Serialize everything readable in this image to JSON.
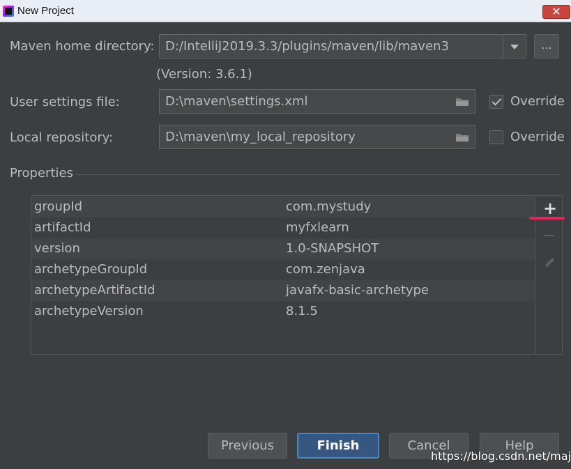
{
  "window": {
    "title": "New Project",
    "close_label": "✕"
  },
  "form": {
    "maven_home": {
      "label": "Maven home directory:",
      "value": "D:/IntelliJ2019.3.3/plugins/maven/lib/maven3",
      "browse_label": "...",
      "version_text": "(Version: 3.6.1)"
    },
    "user_settings": {
      "label": "User settings file:",
      "value": "D:\\maven\\settings.xml",
      "override_label": "Override",
      "override_checked": true
    },
    "local_repo": {
      "label": "Local repository:",
      "value": "D:\\maven\\my_local_repository",
      "override_label": "Override",
      "override_checked": false
    }
  },
  "properties": {
    "title": "Properties",
    "rows": [
      {
        "key": "groupId",
        "value": "com.mystudy"
      },
      {
        "key": "artifactId",
        "value": "myfxlearn"
      },
      {
        "key": "version",
        "value": "1.0-SNAPSHOT"
      },
      {
        "key": "archetypeGroupId",
        "value": "com.zenjava"
      },
      {
        "key": "archetypeArtifactId",
        "value": "javafx-basic-archetype"
      },
      {
        "key": "archetypeVersion",
        "value": "8.1.5"
      }
    ],
    "add_label": "+"
  },
  "buttons": {
    "previous": "Previous",
    "finish": "Finish",
    "cancel": "Cancel",
    "help": "Help"
  },
  "watermark": "https://blog.csdn.net/majian",
  "colors": {
    "background": "#3c3f41",
    "accent": "#365880",
    "highlight_underline": "#e8245a"
  }
}
